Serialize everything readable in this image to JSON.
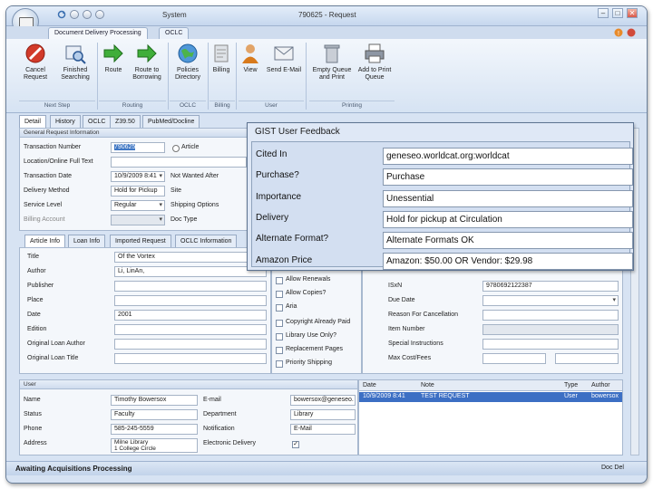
{
  "window": {
    "title": "790625 - Request",
    "system_label": "System"
  },
  "ribbon": {
    "tabs": [
      "Document Delivery Processing",
      "OCLC"
    ],
    "buttons": [
      "Cancel Request",
      "Finished Searching",
      "Route",
      "Route to Borrowing",
      "Policies Directory",
      "Billing",
      "View",
      "Send E-Mail",
      "Empty Queue and Print",
      "Add to Print Queue"
    ],
    "groups": [
      "Next Step",
      "Routing",
      "OCLC",
      "Billing",
      "User",
      "Printing"
    ]
  },
  "detail_tabs": [
    "Detail",
    "History",
    "OCLC",
    "Z39.50",
    "PubMed/Docline"
  ],
  "general": {
    "header": "General Request Information",
    "labels": [
      "Transaction Number",
      "Location/Online Full Text",
      "Transaction Date",
      "Delivery Method",
      "Service Level",
      "Billing Account"
    ],
    "values": [
      "790625",
      "",
      "10/9/2009 8:41",
      "Hold for Pickup",
      "Regular",
      ""
    ],
    "article_label": "Article",
    "right_labels": [
      "Not Wanted After",
      "Site",
      "Shipping Options",
      "Doc Type"
    ]
  },
  "loan_tabs": [
    "Article Info",
    "Loan Info",
    "Imported Request",
    "OCLC Information"
  ],
  "loan": {
    "labels": [
      "Title",
      "Author",
      "Publisher",
      "Place",
      "Date",
      "Edition",
      "Original Loan Author",
      "Original Loan Title"
    ],
    "values": [
      "Of the Vortex",
      "Li, LinAn,",
      "",
      "",
      "2001",
      "",
      "",
      ""
    ]
  },
  "options": [
    "Allow Renewals",
    "Allow Copies?",
    "Aria",
    "Copyright Already Paid",
    "Library Use Only?",
    "Replacement Pages",
    "Priority Shipping"
  ],
  "right_fields": {
    "labels": [
      "ISxN",
      "Due Date",
      "Reason For Cancellation",
      "Item Number",
      "Special Instructions",
      "Max Cost/Fees"
    ],
    "isxn_value": "9780692122387"
  },
  "user": {
    "header": "User",
    "labels": [
      "Name",
      "Status",
      "Phone",
      "Address"
    ],
    "values": [
      "Timothy Bowersox",
      "Faculty",
      "585-245-5559",
      "Milne Library\n1 College Circle"
    ],
    "labels2": [
      "E-mail",
      "Department",
      "Notification",
      "Electronic Delivery"
    ],
    "values2": [
      "bowersox@geneseo.",
      "Library",
      "E-Mail",
      ""
    ]
  },
  "notes": {
    "headers": [
      "Date",
      "Note",
      "Type",
      "Author"
    ],
    "row": [
      "10/9/2009 8:41",
      "TEST REQUEST",
      "User",
      "bowersox"
    ]
  },
  "gist": {
    "title": "GIST User Feedback",
    "rows": [
      {
        "label": "Cited In",
        "value": "geneseo.worldcat.org:worldcat"
      },
      {
        "label": "Purchase?",
        "value": "Purchase"
      },
      {
        "label": "Importance",
        "value": "Unessential"
      },
      {
        "label": "Delivery",
        "value": "Hold for pickup at Circulation"
      },
      {
        "label": "Alternate Format?",
        "value": "Alternate Formats OK"
      },
      {
        "label": "Amazon Price",
        "value": "Amazon: $50.00 OR Vendor: $29.98"
      }
    ]
  },
  "status": {
    "text": "Awaiting Acquisitions Processing",
    "right": "Doc Del"
  },
  "colors": {
    "accent": "#3f77c4",
    "selected_row": "#3c6fc4"
  }
}
